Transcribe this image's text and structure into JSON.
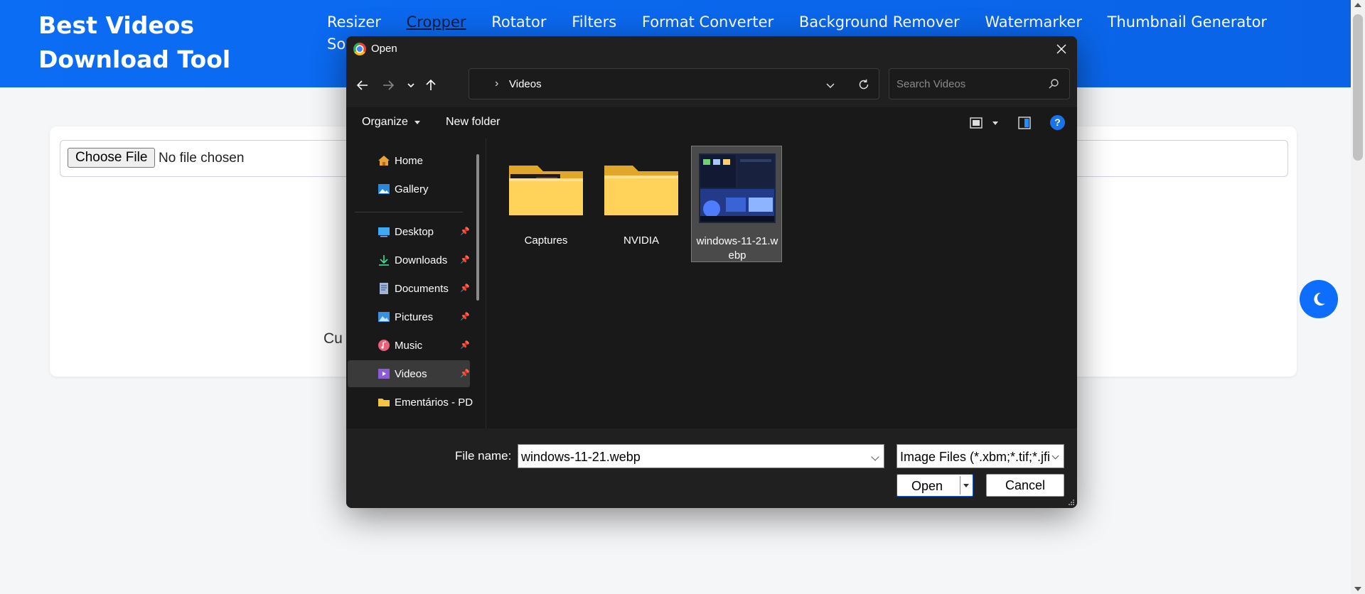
{
  "site": {
    "brand": "Best Videos Download Tool",
    "nav": [
      {
        "label": "Resizer",
        "active": false
      },
      {
        "label": "Cropper",
        "active": true
      },
      {
        "label": "Rotator",
        "active": false
      },
      {
        "label": "Filters",
        "active": false
      },
      {
        "label": "Format Converter",
        "active": false
      },
      {
        "label": "Background Remover",
        "active": false
      },
      {
        "label": "Watermarker",
        "active": false
      },
      {
        "label": "Thumbnail Generator",
        "active": false
      }
    ],
    "nav_overflow": "So",
    "accent_color": "#0d6efd"
  },
  "uploader": {
    "choose_file_label": "Choose File",
    "no_file_text": "No file chosen",
    "partial_text": "Cu"
  },
  "theme_toggle": {
    "icon": "moon-icon"
  },
  "dialog": {
    "title": "Open",
    "address": {
      "path": "Videos"
    },
    "search": {
      "placeholder": "Search Videos"
    },
    "toolbar": {
      "organize": "Organize",
      "new_folder": "New folder",
      "help": "?"
    },
    "sidebar": [
      {
        "label": "Home",
        "icon": "home-icon",
        "pinned": false
      },
      {
        "label": "Gallery",
        "icon": "gallery-icon",
        "pinned": false
      },
      {
        "label": "Desktop",
        "icon": "desktop-icon",
        "pinned": true
      },
      {
        "label": "Downloads",
        "icon": "download-icon",
        "pinned": true
      },
      {
        "label": "Documents",
        "icon": "document-icon",
        "pinned": true
      },
      {
        "label": "Pictures",
        "icon": "pictures-icon",
        "pinned": true
      },
      {
        "label": "Music",
        "icon": "music-icon",
        "pinned": true
      },
      {
        "label": "Videos",
        "icon": "videos-icon",
        "pinned": true,
        "selected": true
      },
      {
        "label": "Ementários - PD",
        "icon": "folder-icon",
        "pinned": false
      }
    ],
    "files": [
      {
        "name": "Captures",
        "type": "folder"
      },
      {
        "name": "NVIDIA",
        "type": "folder"
      },
      {
        "name": "windows-11-21.webp",
        "type": "image",
        "selected": true
      }
    ],
    "file_name_label": "File name:",
    "file_name_value": "windows-11-21.webp",
    "file_type_filter": "Image Files (*.xbm;*.tif;*.jfi",
    "open_label": "Open",
    "cancel_label": "Cancel"
  }
}
